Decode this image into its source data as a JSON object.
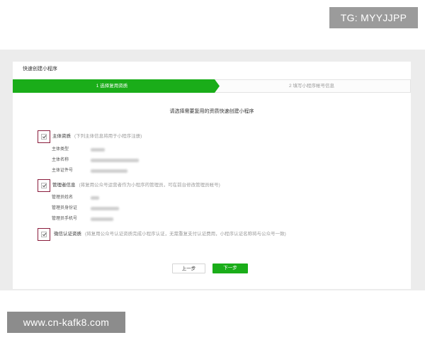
{
  "watermarks": {
    "top": "TG: MYYJJPP",
    "bottom": "www.cn-kafk8.com"
  },
  "card": {
    "title": "快速创建小程序"
  },
  "steps": [
    {
      "label": "1 选择复用资质",
      "active": true
    },
    {
      "label": "2 填写小程序帐号信息",
      "active": false
    }
  ],
  "instruction": "请选择需要复用的资质快速创建小程序",
  "sections": [
    {
      "title": "主体资质",
      "note": "(下列主体信息将用于小程序注册)",
      "checked": true,
      "fields": [
        "主体类型",
        "主体名称",
        "主体证件号"
      ]
    },
    {
      "title": "管理者信息",
      "note": "(将复用公众号运营者作为小程序的管理员，可在前台修改管理员帐号)",
      "checked": true,
      "fields": [
        "管理员姓名",
        "管理员身份证",
        "管理员手机号"
      ]
    },
    {
      "title": "微信认证资质",
      "note": "(将复用公众号认证资质完成小程序认证，无需重复支付认证费用，小程序认证名称将与公众号一致)",
      "checked": true,
      "fields": []
    }
  ],
  "buttons": {
    "prev": "上一步",
    "next": "下一步"
  },
  "colors": {
    "accent": "#1aad19",
    "highlight": "#8a1c3c"
  }
}
